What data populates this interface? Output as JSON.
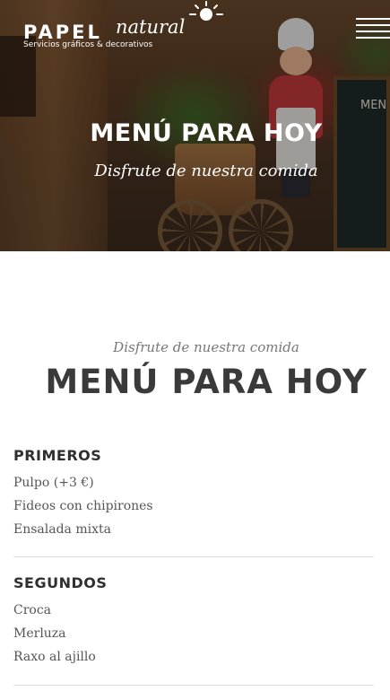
{
  "header": {
    "logo": {
      "brand_bold": "PAPEL",
      "brand_script": "natural",
      "tagline": "Servicios gráficos & decorativos"
    },
    "menu_icon": "hamburger-menu-icon"
  },
  "hero": {
    "title": "MENÚ PARA HOY",
    "subtitle": "Disfrute de nuestra comida",
    "board_text": "MEN"
  },
  "menu_section": {
    "subtitle": "Disfrute de nuestra comida",
    "title": "MENÚ PARA HOY",
    "categories": [
      {
        "heading": "PRIMEROS",
        "items": [
          "Pulpo (+3 €)",
          "Fideos con chipirones",
          "Ensalada mixta"
        ]
      },
      {
        "heading": "SEGUNDOS",
        "items": [
          "Croca",
          "Merluza",
          "Raxo al ajillo"
        ]
      }
    ]
  },
  "colors": {
    "hero_text": "#ffffff",
    "title_text": "#3a3a3a",
    "body_text": "#555555",
    "divider": "#dddddd"
  }
}
